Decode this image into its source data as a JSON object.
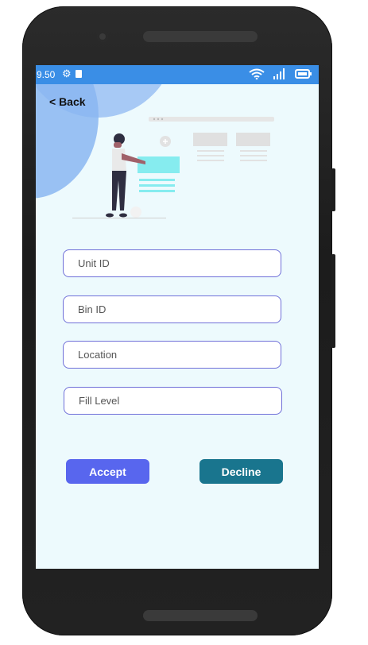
{
  "status_bar": {
    "time": "9.50",
    "icons": [
      "gear-icon",
      "sd-card-icon",
      "wifi-icon",
      "signal-icon",
      "battery-icon"
    ]
  },
  "header": {
    "back_label": "< Back"
  },
  "form": {
    "fields": [
      {
        "placeholder": "Unit ID",
        "value": ""
      },
      {
        "placeholder": "Bin ID",
        "value": ""
      },
      {
        "placeholder": "Location",
        "value": ""
      },
      {
        "placeholder": "Fill Level",
        "value": ""
      }
    ]
  },
  "actions": {
    "accept_label": "Accept",
    "decline_label": "Decline"
  },
  "colors": {
    "status_bar": "#3a8ee6",
    "screen_bg": "#edfafd",
    "accept": "#5866ee",
    "decline": "#19758e",
    "field_border": "#6f6fd8"
  }
}
